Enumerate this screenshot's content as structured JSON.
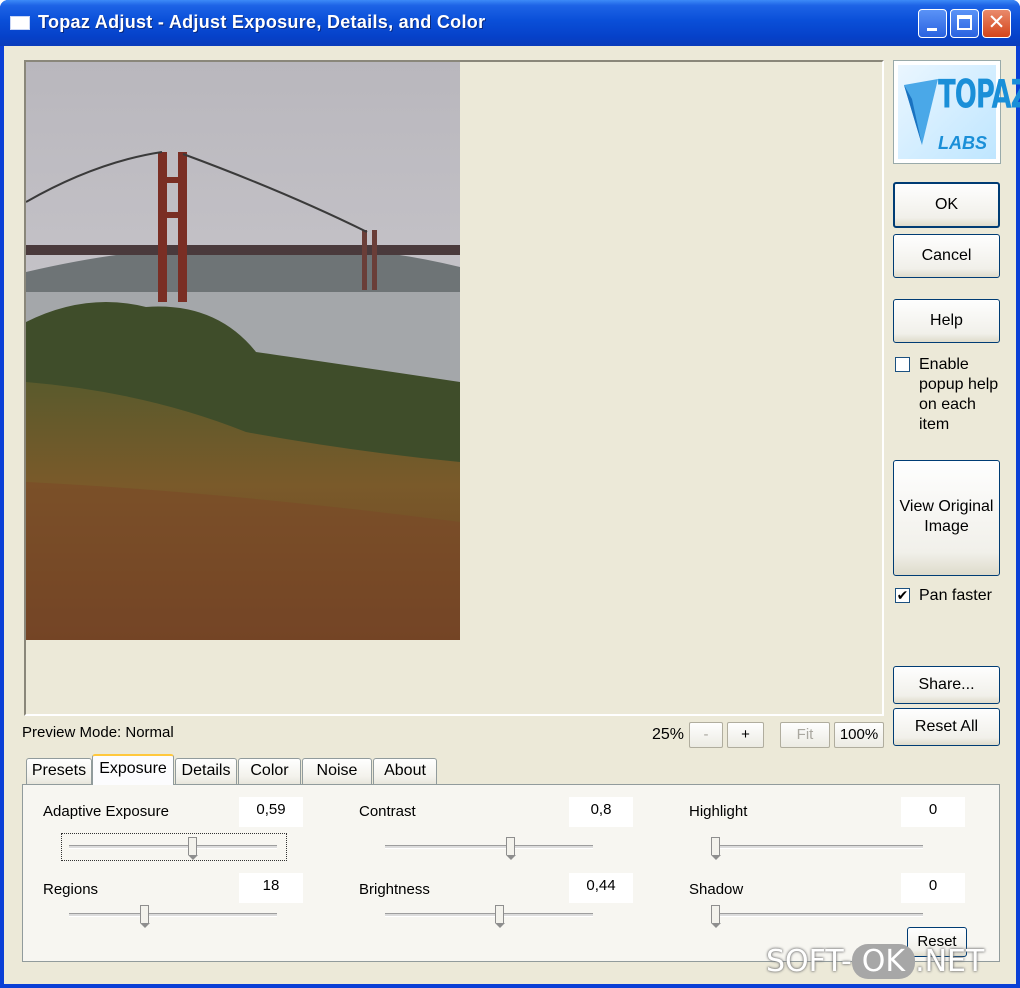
{
  "window": {
    "title": "Topaz Adjust - Adjust Exposure, Details, and Color"
  },
  "logo": {
    "line1": "TOPAZ",
    "line2": "LABS"
  },
  "buttons": {
    "ok": "OK",
    "cancel": "Cancel",
    "help": "Help",
    "view_original": "View Original Image",
    "share": "Share...",
    "reset_all": "Reset All",
    "reset": "Reset"
  },
  "options": {
    "popup_help": {
      "label": "Enable popup help on each item",
      "checked": false
    },
    "pan_faster": {
      "label": "Pan faster",
      "checked": true
    }
  },
  "preview": {
    "mode_label": "Preview Mode: Normal"
  },
  "zoom": {
    "level": "25%",
    "minus": "-",
    "plus": "+",
    "fit": "Fit",
    "hundred": "100%"
  },
  "tabs": [
    {
      "label": "Presets"
    },
    {
      "label": "Exposure",
      "active": true
    },
    {
      "label": "Details"
    },
    {
      "label": "Color"
    },
    {
      "label": "Noise"
    },
    {
      "label": "About"
    }
  ],
  "exposure": {
    "adaptive_exposure": {
      "label": "Adaptive Exposure",
      "value": "0,59",
      "fraction": 0.59
    },
    "regions": {
      "label": "Regions",
      "value": "18",
      "fraction": 0.36
    },
    "contrast": {
      "label": "Contrast",
      "value": "0,8",
      "fraction": 0.6
    },
    "brightness": {
      "label": "Brightness",
      "value": "0,44",
      "fraction": 0.55
    },
    "highlight": {
      "label": "Highlight",
      "value": "0",
      "fraction": 0.0
    },
    "shadow": {
      "label": "Shadow",
      "value": "0",
      "fraction": 0.0
    }
  },
  "watermark": {
    "left": "SOFT-",
    "mid": "OK",
    "right": ".NET"
  }
}
